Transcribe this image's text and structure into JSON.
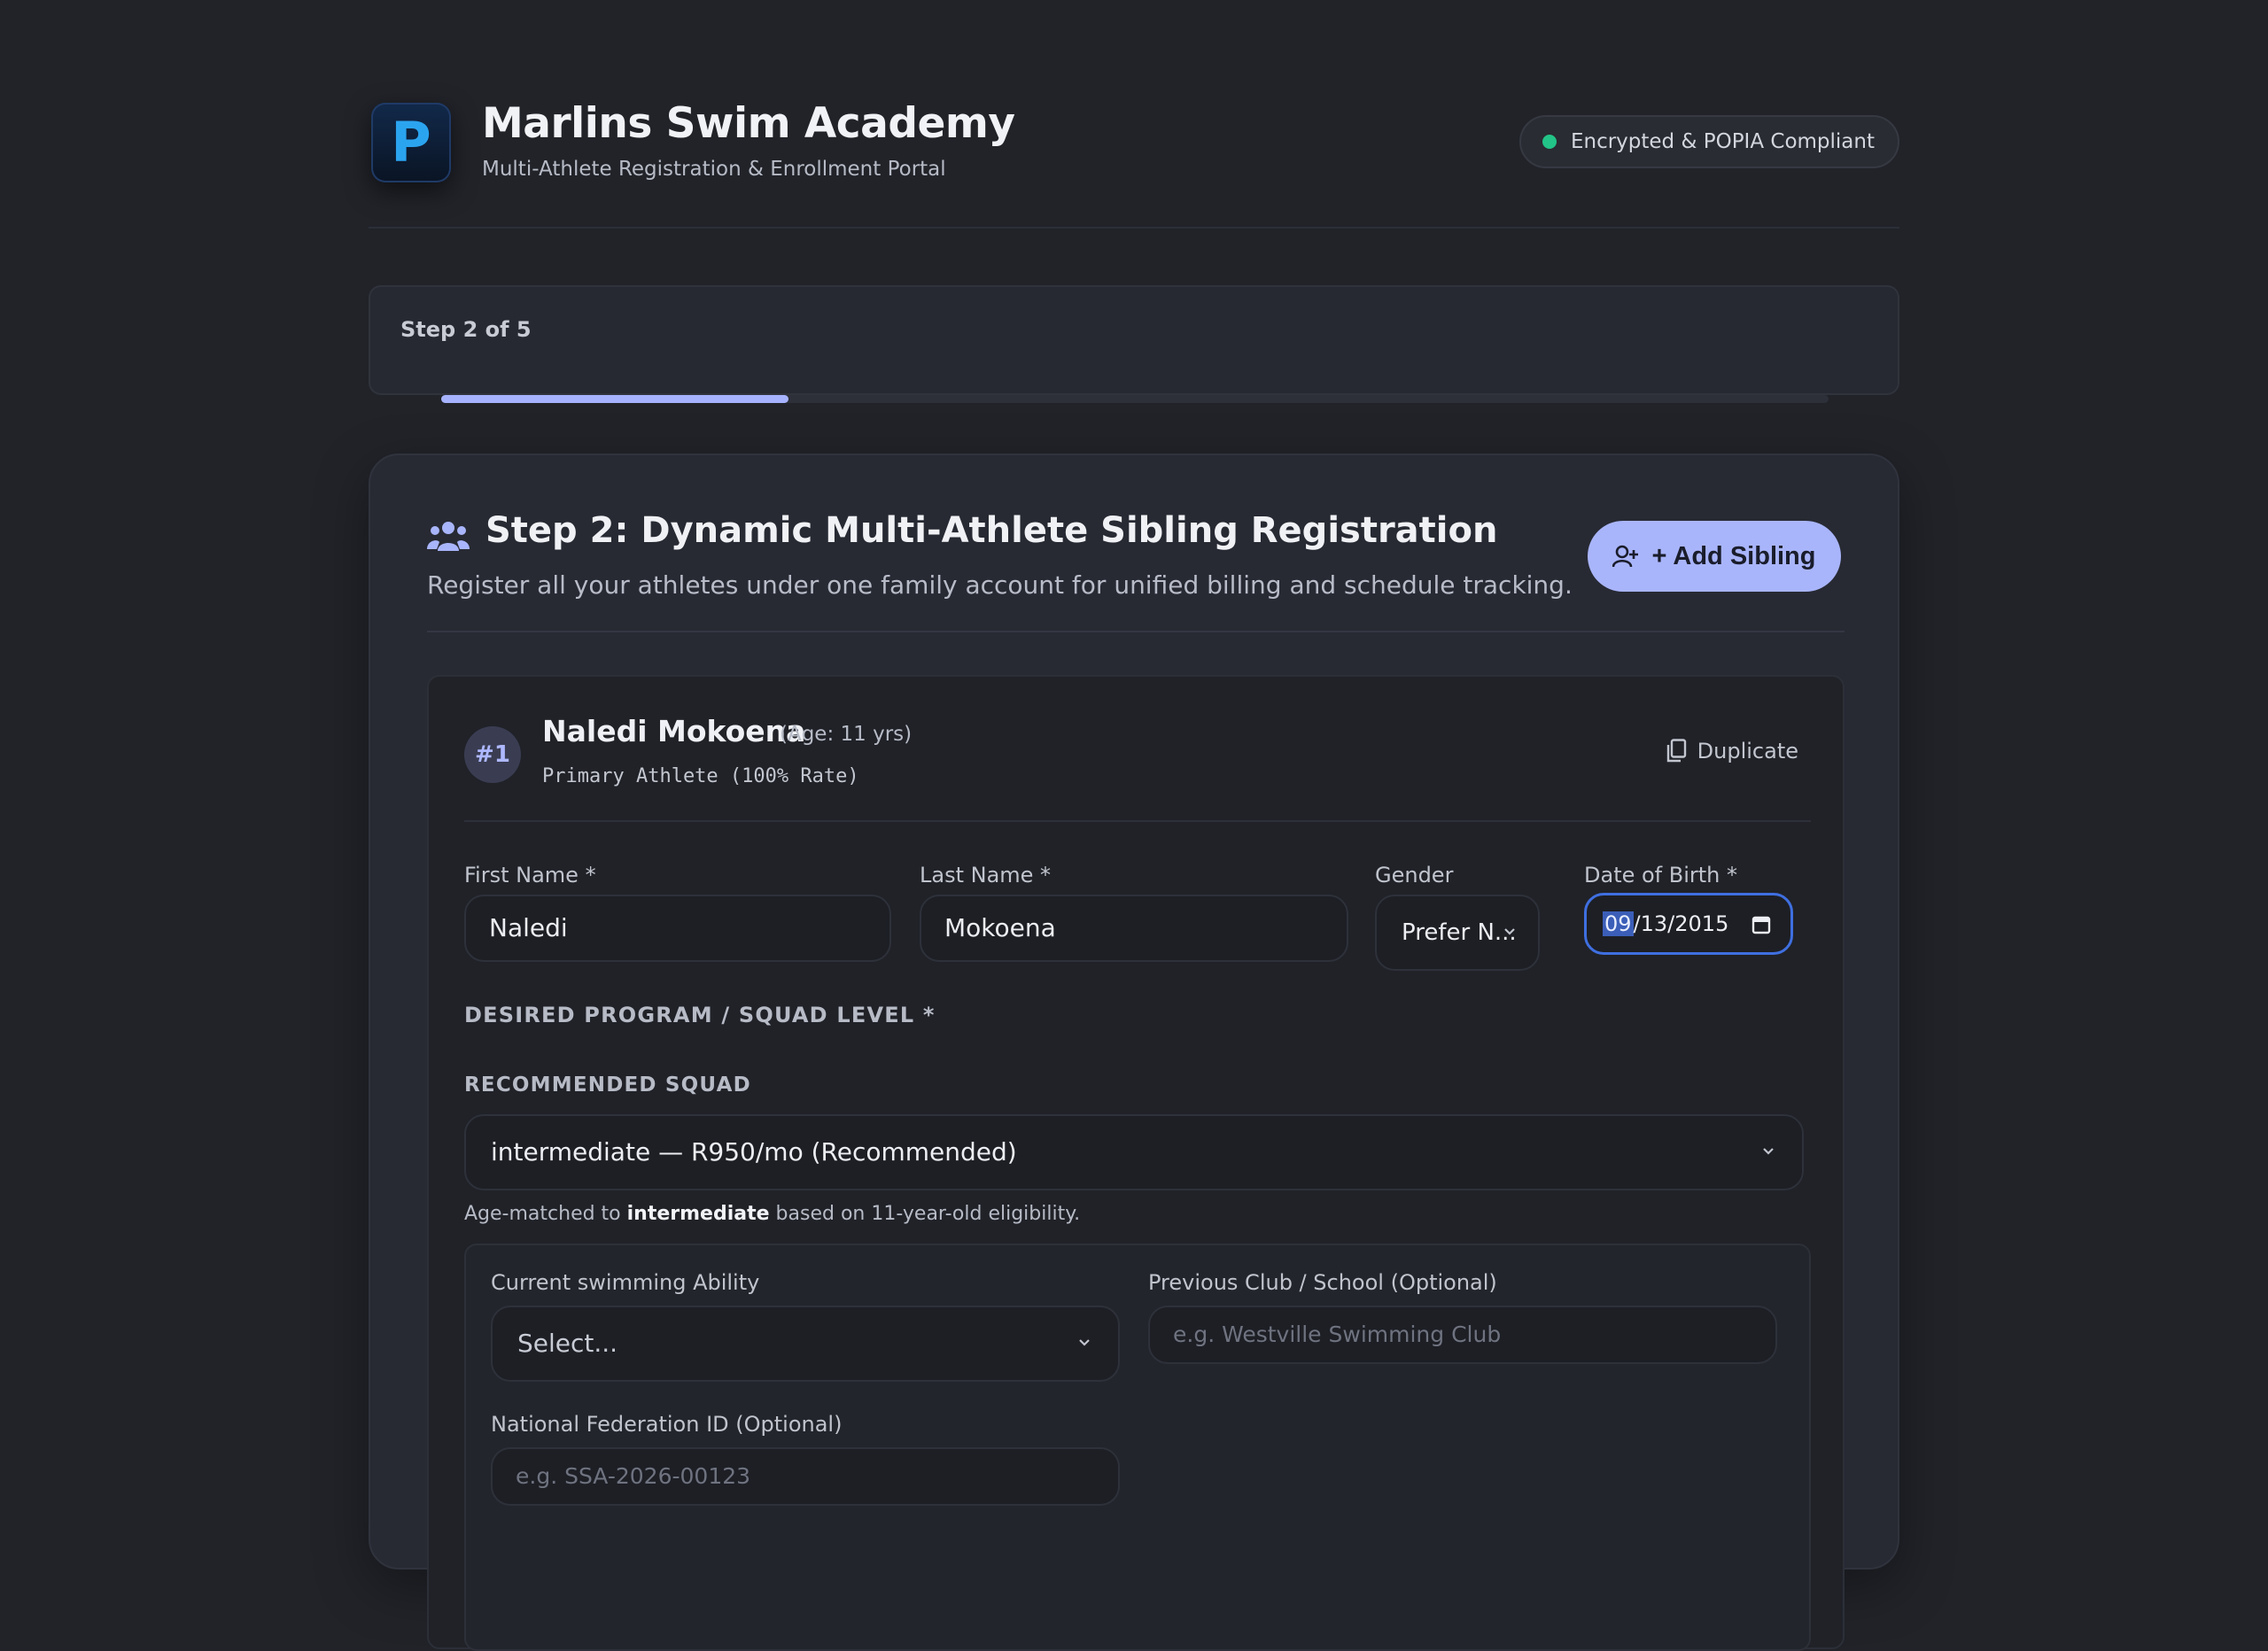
{
  "header": {
    "logo_letter": "P",
    "title": "Marlins Swim Academy",
    "subtitle": "Multi-Athlete Registration & Enrollment Portal",
    "secure_badge": "Encrypted & POPIA Compliant"
  },
  "steps": {
    "label": "Step 2 of 5",
    "progress_fraction": 0.25,
    "colors": {
      "fill": "#a7b2ff",
      "track": "#2d3039"
    }
  },
  "section": {
    "icon": "users-icon",
    "title": "Step 2: Dynamic Multi-Athlete Sibling Registration",
    "description": "Register all your athletes under one family account for unified billing and schedule tracking.",
    "add_button": "+ Add Sibling",
    "add_button_icon": "user-plus-icon"
  },
  "athlete": {
    "number": "#1",
    "name": "Naledi Mokoena",
    "age": "(Age: 11 yrs)",
    "role": "Primary Athlete (100% Rate)",
    "duplicate_label": "Duplicate",
    "duplicate_icon": "copy-icon",
    "fields": {
      "first_name": {
        "label": "First Name *",
        "value": "Naledi"
      },
      "last_name": {
        "label": "Last Name *",
        "value": "Mokoena"
      },
      "gender": {
        "label": "Gender",
        "value": "Prefer N..."
      },
      "dob": {
        "label": "Date of Birth *",
        "month": "09",
        "rest": "/13/2015"
      }
    },
    "program_heading": "DESIRED PROGRAM / SQUAD LEVEL *",
    "recommended_heading": "RECOMMENDED SQUAD",
    "squad_value": "intermediate — R950/mo (Recommended)",
    "hint": {
      "prefix": "Age-matched to ",
      "bold": "intermediate",
      "suffix": " based on 11-year-old eligibility."
    },
    "extra": {
      "ability_label": "Current swimming Ability",
      "ability_value": "Select...",
      "prev_club_label": "Previous Club / School (Optional)",
      "prev_club_placeholder": "e.g. Westville Swimming Club",
      "federation_label": "National Federation ID (Optional)",
      "federation_placeholder": "e.g. SSA-2026-00123"
    }
  },
  "colors": {
    "background": "#212329",
    "accent": "#a9b5fb",
    "focus": "#3f6fe0",
    "status_green": "#22c487"
  }
}
